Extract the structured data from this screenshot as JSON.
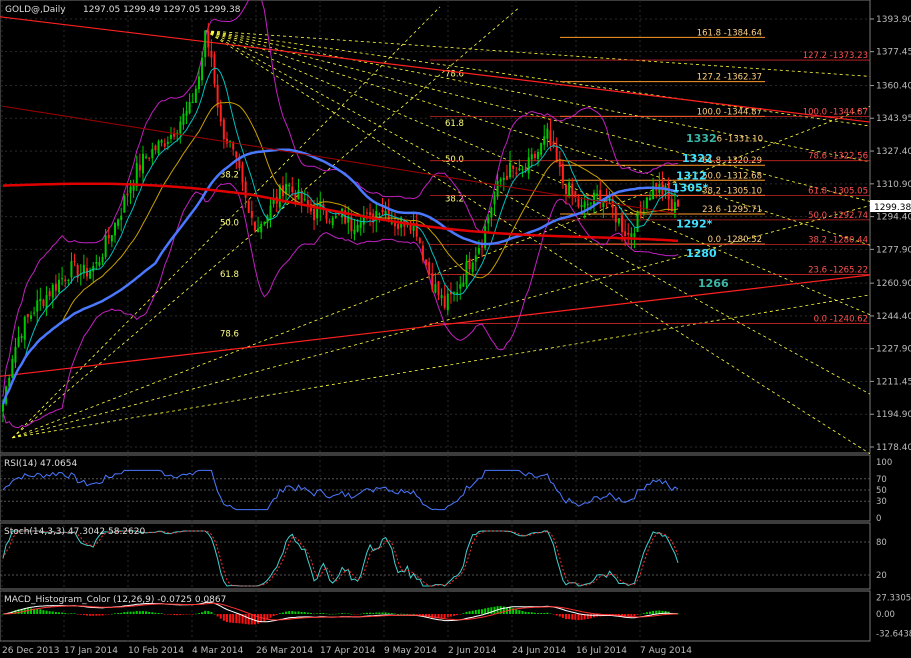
{
  "window": {
    "title": "GOLD@,Daily",
    "quote": "1297.05 1299.49 1297.05 1299.38"
  },
  "colors": {
    "bull": "#00c800",
    "bear": "#ff2020",
    "fib": "#ff9a2a",
    "fibTrend": "#ff3030",
    "ma_blue": "#4a78ff",
    "ma_red": "#e00000",
    "bands": "#c020c0",
    "fan": "#ffff40",
    "grid": "#2a2a2a",
    "axis": "#9a9a9a"
  },
  "main_axis": {
    "labels": [
      "1393.90",
      "1377.45",
      "1360.40",
      "1343.95",
      "1327.40",
      "1310.90",
      "1294.40",
      "1277.90",
      "1260.90",
      "1244.40",
      "1227.90",
      "1211.45",
      "1194.90",
      "1178.40"
    ],
    "current": "1299.38"
  },
  "x_axis": {
    "labels": [
      "26 Dec 2013",
      "17 Jan 2014",
      "10 Feb 2014",
      "4 Mar 2014",
      "26 Mar 2014",
      "17 Apr 2014",
      "9 May 2014",
      "2 Jun 2014",
      "24 Jun 2014",
      "16 Jul 2014",
      "7 Aug 2014"
    ]
  },
  "fib_levels": [
    {
      "text": "161.8 -1384.64",
      "price": 1384.64
    },
    {
      "text": "127.2 -1362.37",
      "price": 1362.37
    },
    {
      "text": "100.0 -1344.87",
      "price": 1344.87
    },
    {
      "text": "61.8 -1320.29",
      "price": 1320.29
    },
    {
      "text": "50.0 -1312.68",
      "price": 1312.68
    },
    {
      "text": "38.2 -1305.10",
      "price": 1305.1
    },
    {
      "text": "23.6 -1295.71",
      "price": 1295.71
    },
    {
      "text": "0.0 -1280.52",
      "price": 1280.52
    }
  ],
  "fib_partial_label": ".6 -1331.10",
  "fib_trend": [
    {
      "text": "127.2 -1373.23",
      "price": 1373.23
    },
    {
      "text": "100.0 -1344.87",
      "price": 1344.87
    },
    {
      "text": "78.6 -1322.56",
      "price": 1322.56
    },
    {
      "text": "61.8 -1305.05",
      "price": 1305.05
    },
    {
      "text": "50.0 -1292.74",
      "price": 1292.74
    },
    {
      "text": "38.2 -1280.44",
      "price": 1280.44
    },
    {
      "text": "23.6 -1265.22",
      "price": 1265.22
    },
    {
      "text": "0.0 -1240.62",
      "price": 1240.62
    }
  ],
  "fan_labels": [
    {
      "text": "78.6",
      "price": 1365
    },
    {
      "text": "61.8",
      "price": 1340
    },
    {
      "text": "50.0",
      "price": 1322
    },
    {
      "text": "38.2",
      "price": 1302
    }
  ],
  "fan_labels_left": [
    {
      "text": "38.2",
      "price": 1314
    },
    {
      "text": "50.0",
      "price": 1290
    },
    {
      "text": "61.8",
      "price": 1264
    },
    {
      "text": "78.6",
      "price": 1234
    }
  ],
  "key_levels": [
    {
      "text": "1332",
      "price": 1332,
      "color": "#3ab7a7"
    },
    {
      "text": "1322",
      "price": 1322,
      "color": "#40e0ff"
    },
    {
      "text": "1312",
      "price": 1313,
      "color": "#40e0ff"
    },
    {
      "text": "1305*",
      "price": 1307,
      "color": "#40e0ff"
    },
    {
      "text": "1292*",
      "price": 1289,
      "color": "#40e0ff"
    },
    {
      "text": "1280",
      "price": 1274,
      "color": "#40e0ff"
    },
    {
      "text": "1266",
      "price": 1259,
      "color": "#3ab7a7"
    }
  ],
  "rsi": {
    "title": "RSI(14) 47.0654",
    "axis": [
      "100",
      "70",
      "50",
      "30",
      "0"
    ]
  },
  "stoch": {
    "title": "Stoch(14,3,3) 47.3042 58.2620",
    "axis": [
      "80",
      "20"
    ]
  },
  "macd": {
    "title": "MACD_Histogram_Color (12,26,9) -0.0725 0.0867",
    "axis": [
      "27.3305",
      "0.00",
      "-32.6438"
    ]
  },
  "chart_data": {
    "type": "candlestick",
    "title": "GOLD@,Daily",
    "ylim": [
      1170,
      1400
    ],
    "x_labels": [
      "26 Dec 2013",
      "17 Jan 2014",
      "10 Feb 2014",
      "4 Mar 2014",
      "26 Mar 2014",
      "17 Apr 2014",
      "9 May 2014",
      "2 Jun 2014",
      "24 Jun 2014",
      "16 Jul 2014",
      "7 Aug 2014"
    ],
    "close_path": [
      [
        0,
        1200
      ],
      [
        3,
        1225
      ],
      [
        6,
        1238
      ],
      [
        10,
        1248
      ],
      [
        14,
        1255
      ],
      [
        18,
        1262
      ],
      [
        22,
        1268
      ],
      [
        26,
        1266
      ],
      [
        30,
        1270
      ],
      [
        34,
        1284
      ],
      [
        38,
        1298
      ],
      [
        42,
        1315
      ],
      [
        46,
        1325
      ],
      [
        50,
        1330
      ],
      [
        54,
        1336
      ],
      [
        57,
        1343
      ],
      [
        60,
        1348
      ],
      [
        63,
        1365
      ],
      [
        65,
        1385
      ],
      [
        67,
        1375
      ],
      [
        70,
        1340
      ],
      [
        73,
        1330
      ],
      [
        76,
        1315
      ],
      [
        79,
        1295
      ],
      [
        82,
        1290
      ],
      [
        85,
        1296
      ],
      [
        88,
        1303
      ],
      [
        91,
        1312
      ],
      [
        94,
        1305
      ],
      [
        97,
        1300
      ],
      [
        100,
        1296
      ],
      [
        103,
        1300
      ],
      [
        106,
        1292
      ],
      [
        109,
        1295
      ],
      [
        112,
        1290
      ],
      [
        115,
        1296
      ],
      [
        118,
        1292
      ],
      [
        121,
        1300
      ],
      [
        124,
        1296
      ],
      [
        127,
        1290
      ],
      [
        130,
        1294
      ],
      [
        133,
        1288
      ],
      [
        136,
        1270
      ],
      [
        139,
        1258
      ],
      [
        142,
        1250
      ],
      [
        145,
        1255
      ],
      [
        148,
        1265
      ],
      [
        151,
        1275
      ],
      [
        154,
        1283
      ],
      [
        157,
        1300
      ],
      [
        160,
        1313
      ],
      [
        163,
        1318
      ],
      [
        166,
        1315
      ],
      [
        169,
        1320
      ],
      [
        172,
        1327
      ],
      [
        175,
        1335
      ],
      [
        177,
        1325
      ],
      [
        180,
        1312
      ],
      [
        183,
        1305
      ],
      [
        186,
        1298
      ],
      [
        189,
        1302
      ],
      [
        192,
        1305
      ],
      [
        195,
        1300
      ],
      [
        198,
        1292
      ],
      [
        201,
        1285
      ],
      [
        204,
        1293
      ],
      [
        207,
        1305
      ],
      [
        210,
        1310
      ],
      [
        213,
        1306
      ],
      [
        215,
        1298
      ],
      [
        217,
        1299.38
      ]
    ]
  }
}
